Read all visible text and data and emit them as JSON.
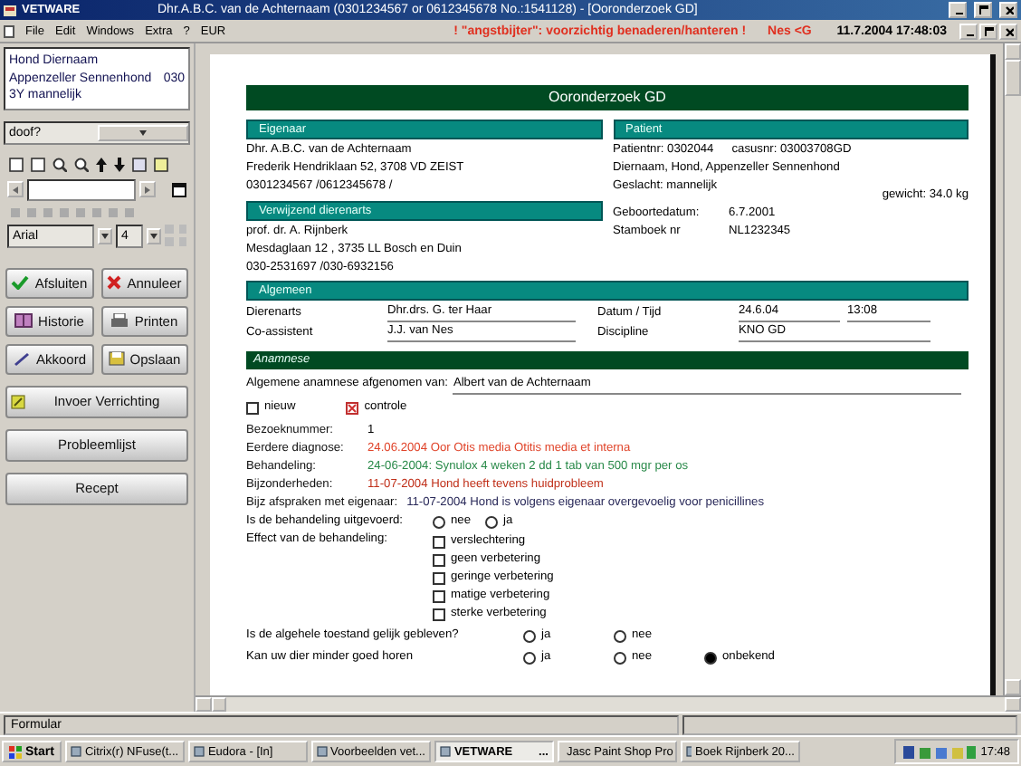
{
  "window": {
    "app_name": "VETWARE",
    "title": "Dhr.A.B.C. van de Achternaam (0301234567 or 0612345678 No.:1541128)   - [Ooronderzoek GD]"
  },
  "menu": [
    "File",
    "Edit",
    "Windows",
    "Extra",
    "?",
    "EUR"
  ],
  "warning": "! \"angstbijter\": voorzichtig benaderen/hanteren !",
  "user_code": "Nes <G",
  "datetime": "11.7.2004 17:48:03",
  "sidebar": {
    "patient_name": "Hond Diernaam",
    "breed": "Appenzeller Sennenhond",
    "code": "030",
    "age_sex": "3Y mannelijk",
    "search": {
      "value": "doof?"
    },
    "font": {
      "family": "Arial",
      "size": "4"
    },
    "buttons": [
      {
        "label": "Afsluiten"
      },
      {
        "label": "Annuleer"
      },
      {
        "label": "Historie"
      },
      {
        "label": "Printen"
      },
      {
        "label": "Akkoord"
      },
      {
        "label": "Opslaan"
      }
    ],
    "wide_buttons": [
      {
        "label": "Invoer Verrichting"
      },
      {
        "label": "Probleemlijst"
      },
      {
        "label": "Recept"
      }
    ]
  },
  "form": {
    "title": "Ooronderzoek GD",
    "owner": {
      "heading": "Eigenaar",
      "lines": [
        "Dhr. A.B.C. van de Achternaam",
        "Frederik Hendriklaan 52, 3708 VD  ZEIST",
        "0301234567 /0612345678 /"
      ]
    },
    "referring_vet": {
      "heading": "Verwijzend dierenarts",
      "lines": [
        "prof. dr. A. Rijnberk",
        "Mesdaglaan 12  ,  3735 LL Bosch en Duin",
        "030-2531697 /030-6932156"
      ]
    },
    "patient": {
      "heading": "Patient",
      "patient_nr": "Patientnr: 0302044",
      "case_nr": "casusnr: 03003708GD",
      "name_line": "Diernaam, Hond, Appenzeller Sennenhond",
      "sex": "Geslacht: mannelijk",
      "weight": "gewicht: 34.0 kg",
      "birth_label": "Geboortedatum:",
      "birth_date": "6.7.2001",
      "studbook_label": "Stamboek nr",
      "studbook_nr": "NL1232345"
    },
    "general": {
      "heading": "Algemeen",
      "vet_label": "Dierenarts",
      "vet": "Dhr.drs. G. ter Haar",
      "date_label": "Datum / Tijd",
      "date": "24.6.04",
      "time": "13:08",
      "assistant_label": "Co-assistent",
      "assistant": "J.J. van Nes",
      "discipline_label": "Discipline",
      "discipline": "KNO GD"
    },
    "anamnese": {
      "heading": "Anamnese",
      "taken_from_label": "Algemene anamnese afgenomen van:",
      "taken_from": "Albert van de Achternaam",
      "checkboxes": [
        {
          "label": "nieuw",
          "checked": false
        },
        {
          "label": "controle",
          "checked": true
        }
      ],
      "info": [
        {
          "label": "Bezoeknummer:",
          "value": "1",
          "color": "#000000"
        },
        {
          "label": "Eerdere diagnose:",
          "value": "24.06.2004 Oor Otis media Otitis media et interna",
          "color": "#e0442a"
        },
        {
          "label": "Behandeling:",
          "value": "24-06-2004: Synulox 4 weken 2 dd 1 tab van 500 mgr per os",
          "color": "#2a8a4a"
        },
        {
          "label": "Bijzonderheden:",
          "value": "11-07-2004 Hond heeft tevens huidprobleem",
          "color": "#c0301a"
        },
        {
          "label": "Bijz afspraken met eigenaar:",
          "value": "11-07-2004 Hond is volgens eigenaar overgevoelig voor penicillines",
          "color": "#2a2a5a"
        }
      ],
      "questions": [
        {
          "kind": "radio_inline",
          "label": "Is de behandeling uitgevoerd:",
          "options": [
            {
              "label": "nee",
              "selected": false
            },
            {
              "label": "ja",
              "selected": false
            }
          ]
        },
        {
          "kind": "checklist",
          "label": "Effect van de behandeling:",
          "options": [
            {
              "label": "verslechtering",
              "checked": false
            },
            {
              "label": "geen verbetering",
              "checked": false
            },
            {
              "label": "geringe verbetering",
              "checked": false
            },
            {
              "label": "matige verbetering",
              "checked": false
            },
            {
              "label": "sterke verbetering",
              "checked": false
            }
          ]
        },
        {
          "kind": "radio_grid",
          "label": "Is de algehele toestand gelijk gebleven?",
          "options": [
            {
              "label": "ja",
              "selected": false
            },
            {
              "label": "nee",
              "selected": false
            }
          ]
        },
        {
          "kind": "radio_grid",
          "label": "Kan uw dier minder goed horen",
          "options": [
            {
              "label": "ja",
              "selected": false
            },
            {
              "label": "nee",
              "selected": false
            },
            {
              "label": "onbekend",
              "selected": true
            }
          ]
        }
      ]
    }
  },
  "status_bar": {
    "text": "Formular"
  },
  "taskbar": {
    "start": "Start",
    "clock": "17:48",
    "items": [
      {
        "label": "Citrix(r) NFuse(t...",
        "selected": false
      },
      {
        "label": "Eudora - [In]",
        "selected": false
      },
      {
        "label": "Voorbeelden vet...",
        "selected": false
      },
      {
        "label": "VETWARE",
        "more": "...",
        "selected": true
      },
      {
        "label": "Jasc Paint Shop Pro",
        "selected": false
      },
      {
        "label": "Boek Rijnberk 20...",
        "selected": false
      }
    ]
  }
}
